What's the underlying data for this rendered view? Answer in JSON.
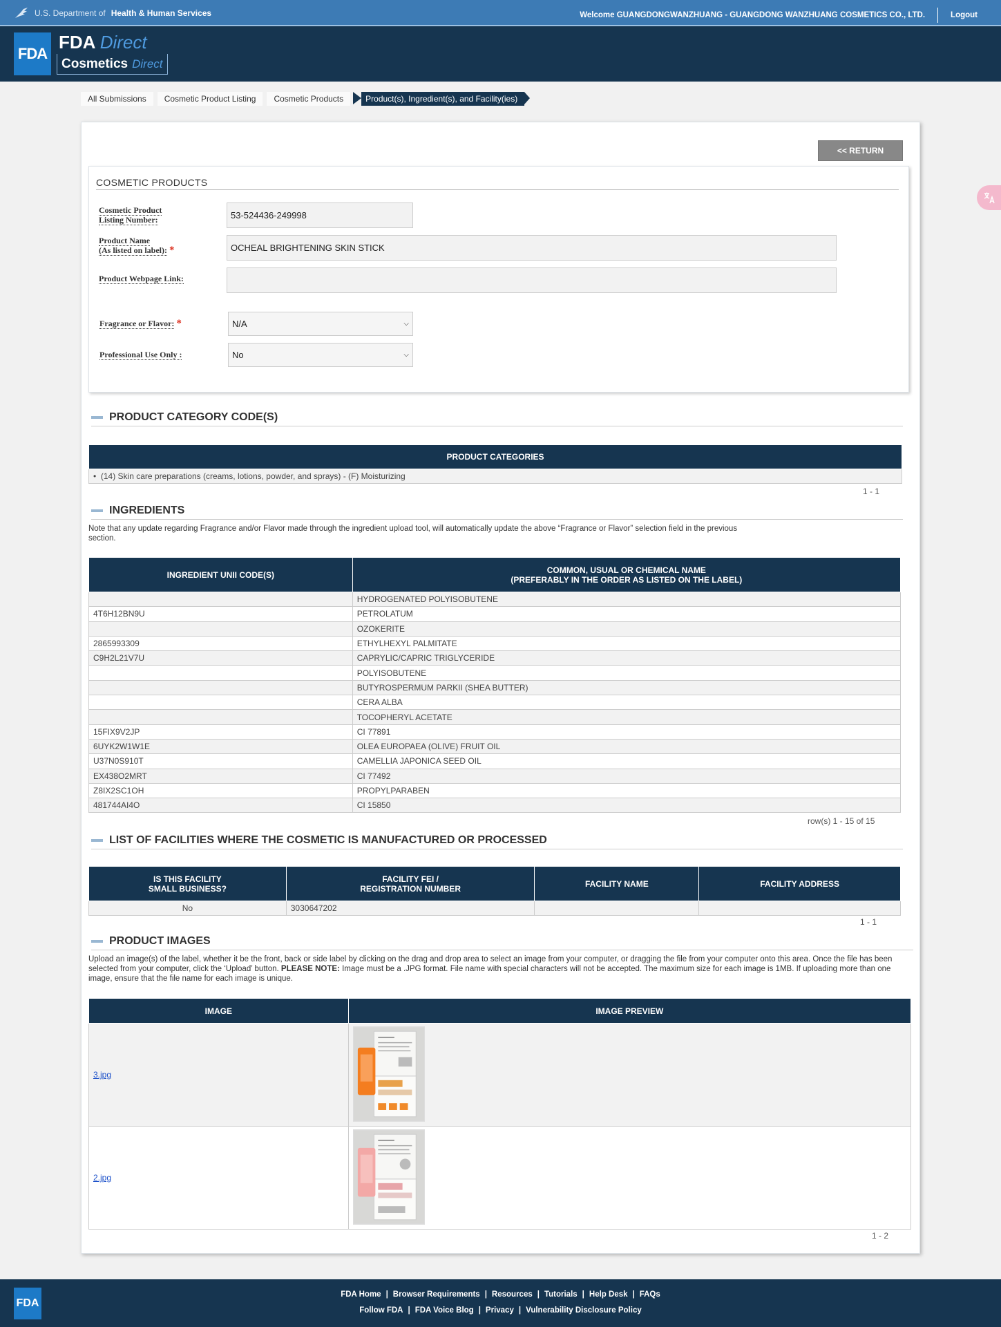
{
  "header": {
    "dept_prefix": "U.S. Department of",
    "dept_name": "Health & Human Services",
    "welcome": "Welcome GUANGDONGWANZHUANG - GUANGDONG WANZHUANG COSMETICS CO., LTD.",
    "logout": "Logout",
    "fda_logo": "FDA",
    "fda": "FDA",
    "direct": "Direct",
    "cosmetics": "Cosmetics",
    "cosmetics_direct": "Direct"
  },
  "breadcrumb": [
    "All Submissions",
    "Cosmetic Product Listing",
    "Cosmetic Products",
    "Product(s), Ingredient(s), and Facility(ies)"
  ],
  "return_label": "<< RETURN",
  "products": {
    "title": "COSMETIC PRODUCTS",
    "listing_label_1": "Cosmetic Product",
    "listing_label_2": "Listing Number:",
    "listing_value": "53-524436-249998",
    "name_label_1": "Product Name",
    "name_label_2": "(As listed on label):",
    "name_value": "OCHEAL BRIGHTENING SKIN STICK",
    "webpage_label": "Product Webpage Link:",
    "webpage_value": "",
    "fragrance_label": "Fragrance or Flavor:",
    "fragrance_value": "N/A",
    "professional_label": "Professional Use Only :",
    "professional_value": "No"
  },
  "category": {
    "title": "PRODUCT CATEGORY CODE(S)",
    "header": "PRODUCT CATEGORIES",
    "item": "(14) Skin care preparations (creams, lotions, powder, and sprays) - (F) Moisturizing",
    "pager": "1 - 1"
  },
  "ingredients": {
    "title": "INGREDIENTS",
    "note": "Note that any update regarding Fragrance and/or Flavor made through the ingredient upload tool, will automatically update the above “Fragrance or Flavor” selection field in the previous section.",
    "col1": "INGREDIENT UNII CODE(S)",
    "col2_line1": "COMMON, USUAL OR CHEMICAL NAME",
    "col2_line2": "(PREFERABLY IN THE ORDER AS LISTED ON THE LABEL)",
    "rows": [
      {
        "code": "",
        "name": "HYDROGENATED POLYISOBUTENE"
      },
      {
        "code": "4T6H12BN9U",
        "name": "PETROLATUM"
      },
      {
        "code": "",
        "name": "OZOKERITE"
      },
      {
        "code": "2865993309",
        "name": "ETHYLHEXYL PALMITATE"
      },
      {
        "code": "C9H2L21V7U",
        "name": "CAPRYLIC/CAPRIC TRIGLYCERIDE"
      },
      {
        "code": "",
        "name": "POLYISOBUTENE"
      },
      {
        "code": "",
        "name": "BUTYROSPERMUM PARKII (SHEA BUTTER)"
      },
      {
        "code": "",
        "name": "CERA ALBA"
      },
      {
        "code": "",
        "name": "TOCOPHERYL ACETATE"
      },
      {
        "code": "15FIX9V2JP",
        "name": "CI 77891"
      },
      {
        "code": "6UYK2W1W1E",
        "name": "OLEA EUROPAEA (OLIVE) FRUIT OIL"
      },
      {
        "code": "U37N0S910T",
        "name": "CAMELLIA JAPONICA SEED OIL"
      },
      {
        "code": "EX438O2MRT",
        "name": "CI 77492"
      },
      {
        "code": "Z8IX2SC1OH",
        "name": "PROPYLPARABEN"
      },
      {
        "code": "481744AI4O",
        "name": "CI 15850"
      }
    ],
    "pager": "row(s) 1 - 15 of 15"
  },
  "facilities": {
    "title": "LIST OF FACILITIES WHERE THE COSMETIC IS MANUFACTURED OR PROCESSED",
    "col1_line1": "IS THIS FACILITY",
    "col1_line2": "SMALL BUSINESS?",
    "col2_line1": "FACILITY FEI /",
    "col2_line2": "REGISTRATION NUMBER",
    "col3": "FACILITY NAME",
    "col4": "FACILITY ADDRESS",
    "row": {
      "small_business": "No",
      "fei": "3030647202",
      "name": "",
      "address": ""
    },
    "pager": "1 - 1"
  },
  "images": {
    "title": "PRODUCT IMAGES",
    "note_1": "Upload an image(s) of the label, whether it be the front, back or side label by clicking on the drag and drop area to select an image from your computer, or dragging the file from your computer onto this area. Once the file has been selected from your computer, click the ‘Upload’ button.",
    "note_bold": "PLEASE NOTE:",
    "note_2": "Image must be a .JPG format. File name with special characters will not be accepted. The maximum size for each image is 1MB. If uploading more than one image, ensure that the file name for each image is unique.",
    "col1": "IMAGE",
    "col2": "IMAGE PREVIEW",
    "files": [
      "3.jpg",
      "2.jpg"
    ],
    "pager": "1 - 2"
  },
  "footer": {
    "logo": "FDA",
    "row1": [
      "FDA Home",
      "Browser Requirements",
      "Resources",
      "Tutorials",
      "Help Desk",
      "FAQs"
    ],
    "row2": [
      "Follow FDA",
      "FDA Voice Blog",
      "Privacy",
      "Vulnerability Disclosure Policy"
    ],
    "sep": "|"
  },
  "colors": {
    "navy": "#163550",
    "hhs_blue": "#3d7bb5",
    "accent_blue": "#1d7ac7",
    "required": "#dd3322"
  }
}
